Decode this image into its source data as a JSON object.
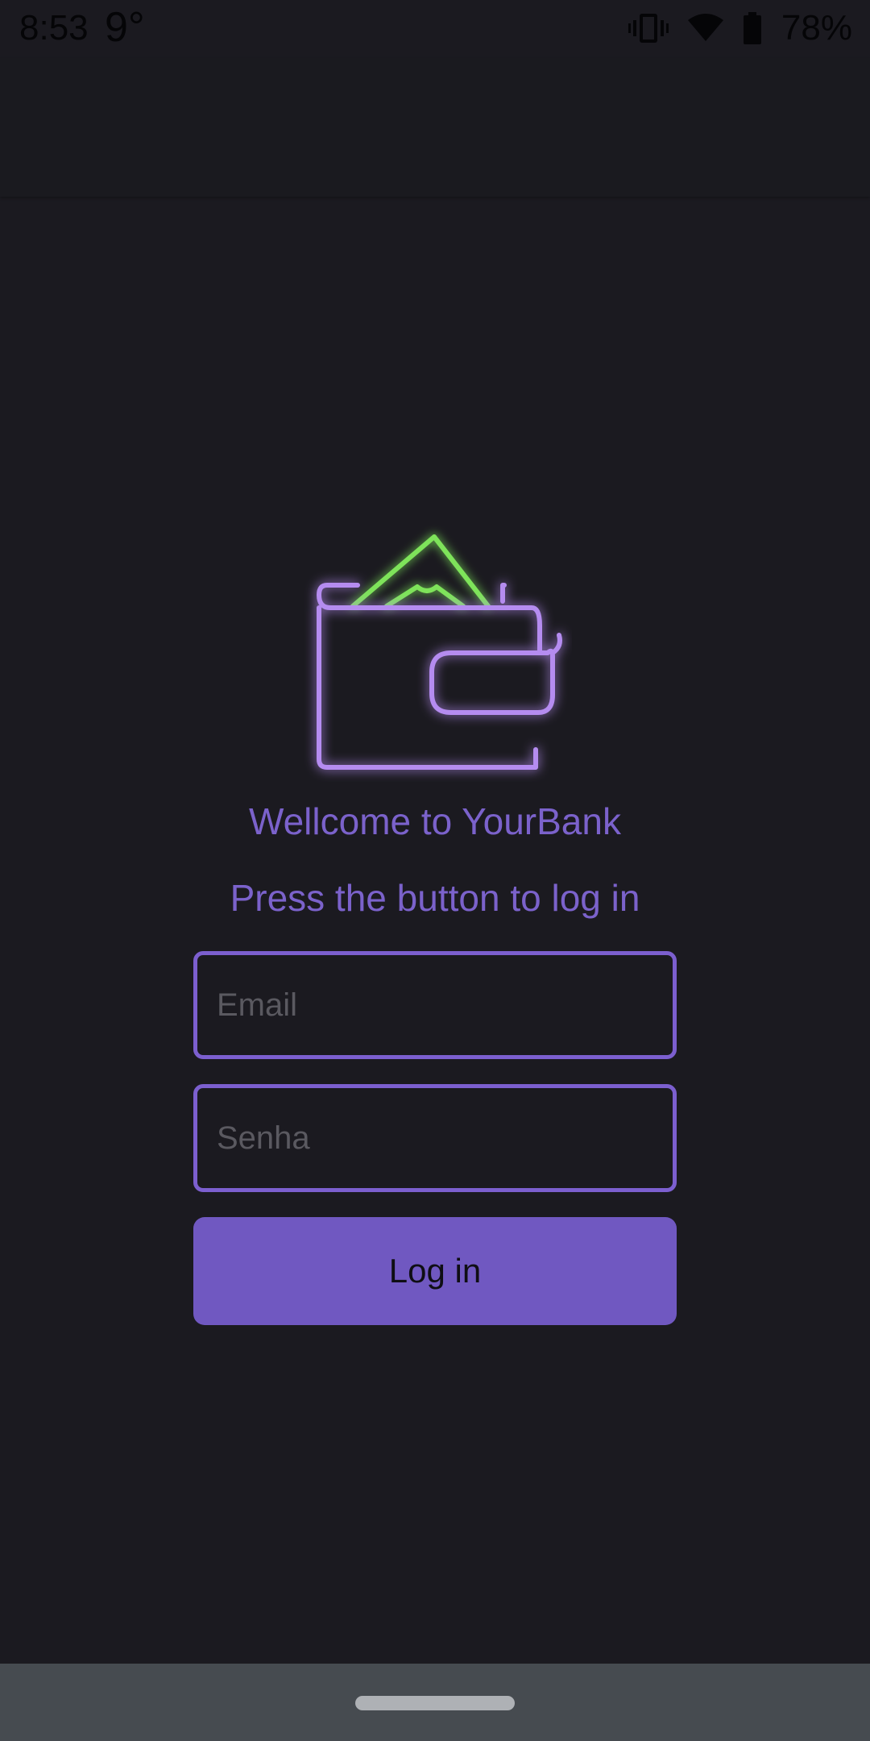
{
  "status_bar": {
    "time": "8:53",
    "temperature": "9°",
    "battery": "78%",
    "icons": [
      "vibrate-icon",
      "wifi-icon",
      "battery-icon"
    ]
  },
  "logo": {
    "icon": "wallet-icon",
    "colors": {
      "wallet": "#b58cf0",
      "money": "#7ee35a"
    }
  },
  "welcome_text": "Wellcome to YourBank",
  "subtitle_text": "Press the button to log in",
  "email": {
    "value": "",
    "placeholder": "Email"
  },
  "password": {
    "value": "",
    "placeholder": "Senha"
  },
  "login_button_label": "Log in",
  "colors": {
    "background": "#1b1a20",
    "accent": "#7058c1",
    "text_accent": "#7b62cb",
    "nav_bar": "#464b50"
  }
}
